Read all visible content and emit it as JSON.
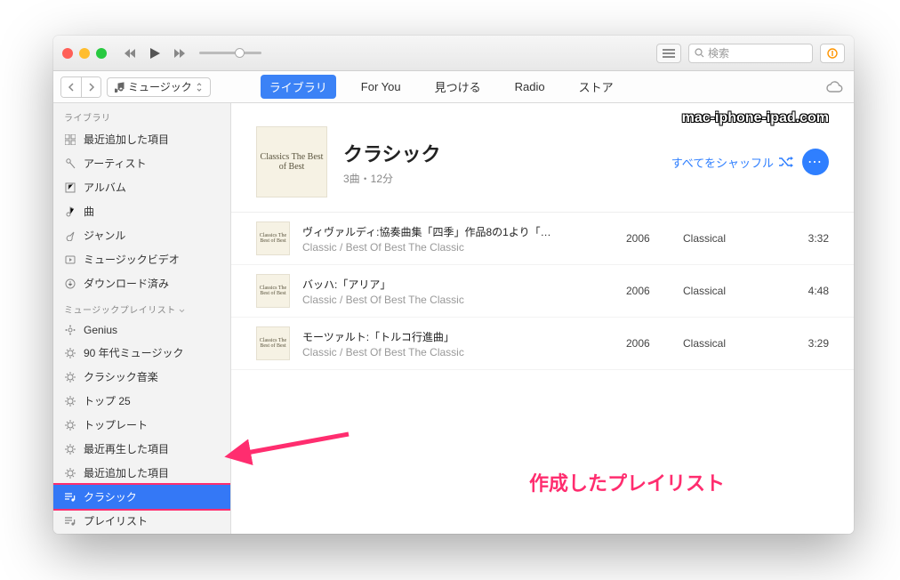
{
  "toolbar": {
    "search_placeholder": "検索"
  },
  "nav": {
    "media_label": "ミュージック",
    "tabs": [
      "ライブラリ",
      "For You",
      "見つける",
      "Radio",
      "ストア"
    ]
  },
  "sidebar": {
    "library_head": "ライブラリ",
    "library_items": [
      {
        "label": "最近追加した項目"
      },
      {
        "label": "アーティスト"
      },
      {
        "label": "アルバム"
      },
      {
        "label": "曲"
      },
      {
        "label": "ジャンル"
      },
      {
        "label": "ミュージックビデオ"
      },
      {
        "label": "ダウンロード済み"
      }
    ],
    "playlists_head": "ミュージックプレイリスト",
    "playlist_items": [
      {
        "label": "Genius"
      },
      {
        "label": "90 年代ミュージック"
      },
      {
        "label": "クラシック音楽"
      },
      {
        "label": "トップ 25"
      },
      {
        "label": "トップレート"
      },
      {
        "label": "最近再生した項目"
      },
      {
        "label": "最近追加した項目"
      },
      {
        "label": "クラシック"
      },
      {
        "label": "プレイリスト"
      }
    ]
  },
  "playlist": {
    "title": "クラシック",
    "meta": "3曲・12分",
    "shuffle_label": "すべてをシャッフル",
    "album_art_text": "Classics\nThe Best\nof Best",
    "tracks": [
      {
        "name": "ヴィヴァルディ:協奏曲集「四季」作品8の1より「…",
        "sub": "Classic / Best Of Best The Classic",
        "year": "2006",
        "genre": "Classical",
        "dur": "3:32"
      },
      {
        "name": "バッハ:「アリア」",
        "sub": "Classic / Best Of Best The Classic",
        "year": "2006",
        "genre": "Classical",
        "dur": "4:48"
      },
      {
        "name": "モーツァルト:「トルコ行進曲」",
        "sub": "Classic / Best Of Best The Classic",
        "year": "2006",
        "genre": "Classical",
        "dur": "3:29"
      }
    ]
  },
  "watermark": "mac-iphone-ipad.com",
  "annotation": "作成したプレイリスト"
}
